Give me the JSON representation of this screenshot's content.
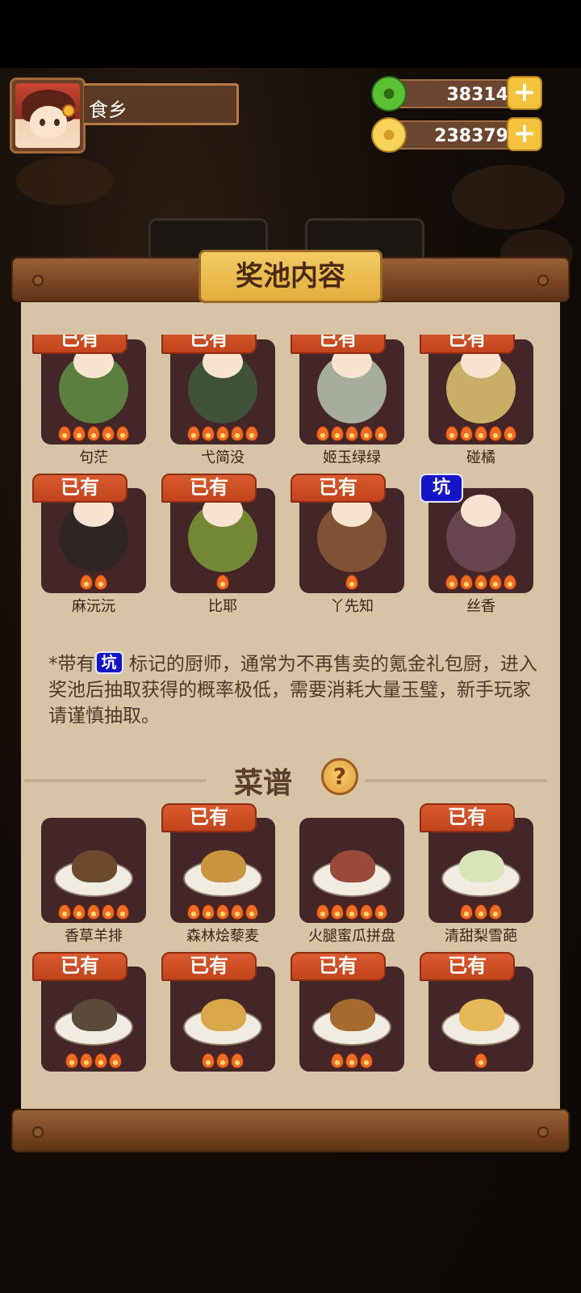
{
  "profile": {
    "name": "食乡"
  },
  "currency": {
    "jade": "38314",
    "coins": "238379",
    "plus": "+"
  },
  "panel": {
    "title": "奖池内容"
  },
  "tags": {
    "owned": "已有",
    "keng": "坑"
  },
  "chefs": [
    {
      "name": "句茫",
      "owned": true,
      "keng": false,
      "stars": 5,
      "color": "#5f8f42"
    },
    {
      "name": "弋简没",
      "owned": true,
      "keng": false,
      "stars": 5,
      "color": "#3d5a3a"
    },
    {
      "name": "姬玉绿绿",
      "owned": true,
      "keng": false,
      "stars": 5,
      "color": "#b9c6b0"
    },
    {
      "name": "碰橘",
      "owned": true,
      "keng": false,
      "stars": 5,
      "color": "#e0c870"
    },
    {
      "name": "麻沅沅",
      "owned": true,
      "keng": false,
      "stars": 2,
      "color": "#2d2624"
    },
    {
      "name": "比耶",
      "owned": true,
      "keng": false,
      "stars": 1,
      "color": "#7a9a36"
    },
    {
      "name": "丫先知",
      "owned": true,
      "keng": false,
      "stars": 1,
      "color": "#8a5a35"
    },
    {
      "name": "丝香",
      "owned": false,
      "keng": true,
      "stars": 5,
      "color": "#6e4b55"
    }
  ],
  "note": {
    "prefix": "*带有",
    "keng": "坑",
    "text": "标记的厨师，通常为不再售卖的氪金礼包厨，进入奖池后抽取获得的概率极低，需要消耗大量玉璧，新手玩家请谨慎抽取。"
  },
  "recipes_section": {
    "title": "菜谱",
    "help": "?"
  },
  "recipes": [
    {
      "name": "香草羊排",
      "owned": false,
      "stars": 5,
      "color": "#6b4a2e"
    },
    {
      "name": "森林烩藜麦",
      "owned": true,
      "keng": false,
      "stars": 5,
      "color": "#c9963f"
    },
    {
      "name": "火腿蜜瓜拼盘",
      "owned": false,
      "stars": 5,
      "color": "#9b4a3a"
    },
    {
      "name": "清甜梨雪葩",
      "owned": true,
      "stars": 3,
      "color": "#d9e4b8"
    },
    {
      "name": "",
      "owned": true,
      "stars": 4,
      "color": "#5a4a3a"
    },
    {
      "name": "",
      "owned": true,
      "stars": 3,
      "color": "#d8a84a"
    },
    {
      "name": "",
      "owned": true,
      "stars": 3,
      "color": "#a66a2e"
    },
    {
      "name": "",
      "owned": true,
      "stars": 1,
      "color": "#e6b85a"
    }
  ]
}
